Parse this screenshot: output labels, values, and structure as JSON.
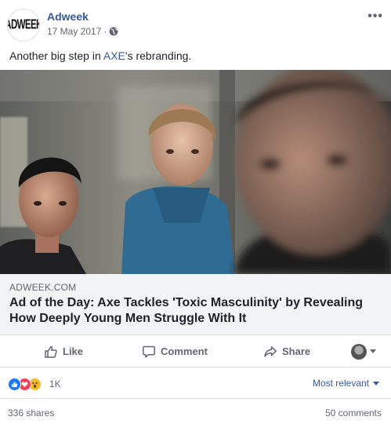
{
  "header": {
    "logo_text": "ADWEEK",
    "page_name": "Adweek",
    "date": "17 May 2017",
    "separator": "·",
    "audience_icon": "globe-icon",
    "more_label": "•••"
  },
  "post": {
    "caption_before": "Another big step in ",
    "caption_link": "AXE",
    "caption_after": "'s rebranding."
  },
  "link_preview": {
    "domain": "ADWEEK.COM",
    "title": "Ad of the Day: Axe Tackles 'Toxic Masculinity' by Revealing How Deeply Young Men Struggle With It"
  },
  "actions": {
    "like_label": "Like",
    "comment_label": "Comment",
    "share_label": "Share"
  },
  "reactions": {
    "icons": [
      "like-reaction-icon",
      "love-reaction-icon",
      "wow-reaction-icon"
    ],
    "count": "1K",
    "sort_label": "Most relevant"
  },
  "footer": {
    "shares": "336 shares",
    "comments": "50 comments"
  },
  "colors": {
    "link": "#385898",
    "like": "#1877f2",
    "love": "#f33e58",
    "wow": "#f7b928"
  }
}
